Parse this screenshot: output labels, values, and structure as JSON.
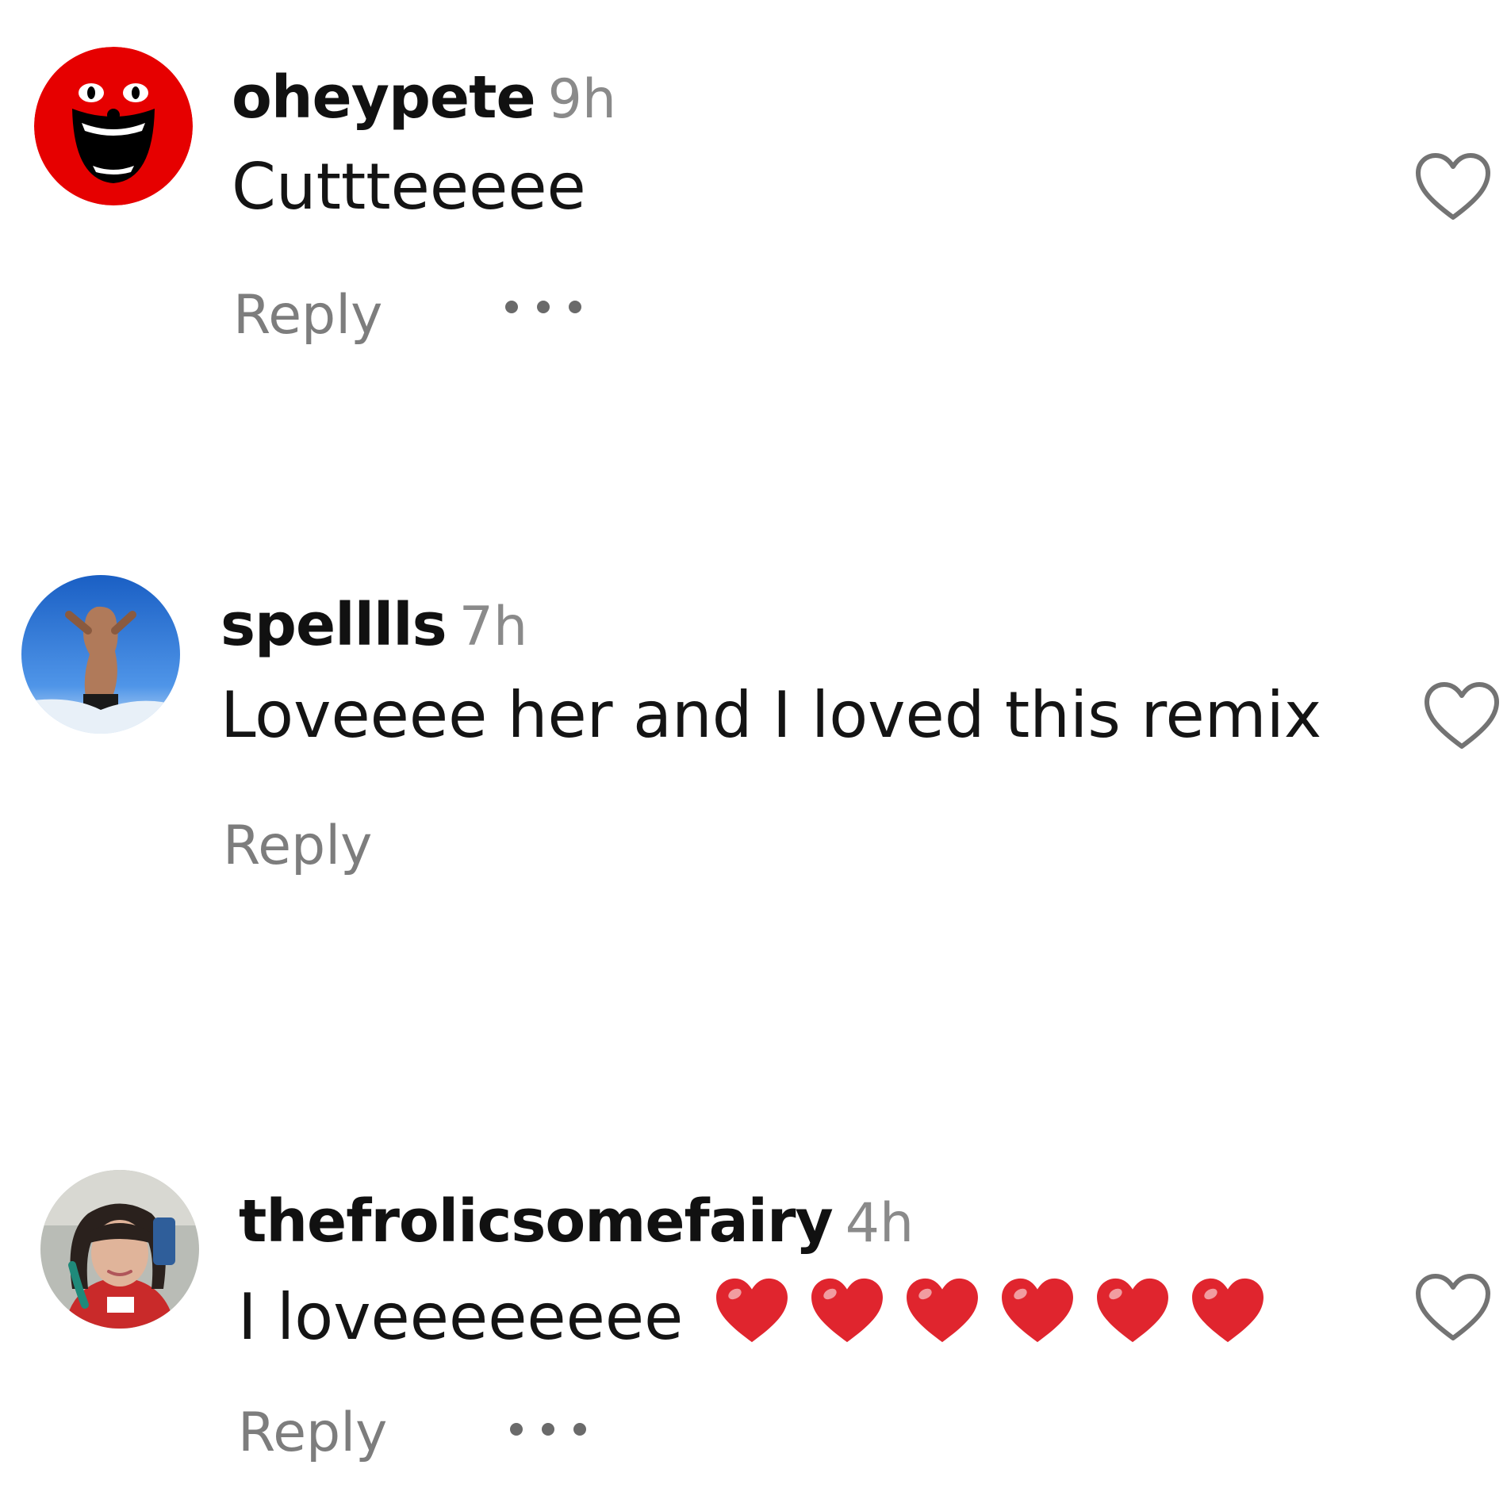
{
  "comments": [
    {
      "username": "oheypete",
      "time": "9h",
      "text": "Cuttteeeee",
      "reply_label": "Reply",
      "has_more_menu": true,
      "avatar_icon": "red-laughing-face-avatar",
      "like_icon": "heart-outline-icon"
    },
    {
      "username": "spelllls",
      "time": "7h",
      "text": "Loveeee her and I loved this remix",
      "reply_label": "Reply",
      "has_more_menu": false,
      "avatar_icon": "photo-avatar-sky",
      "like_icon": "heart-outline-icon"
    },
    {
      "username": "thefrolicsomefairy",
      "time": "4h",
      "text": "I loveeeeeeee",
      "emoji": [
        "❤️",
        "❤️",
        "❤️",
        "❤️",
        "❤️",
        "❤️"
      ],
      "reply_label": "Reply",
      "has_more_menu": true,
      "avatar_icon": "photo-avatar-selfie",
      "like_icon": "heart-outline-icon"
    }
  ],
  "colors": {
    "username": "#111111",
    "timestamp": "#8a8a8a",
    "reply": "#7d7d7d",
    "heart_outline": "#737373",
    "emoji_heart": "#e0252e",
    "avatar_red": "#e60000"
  }
}
